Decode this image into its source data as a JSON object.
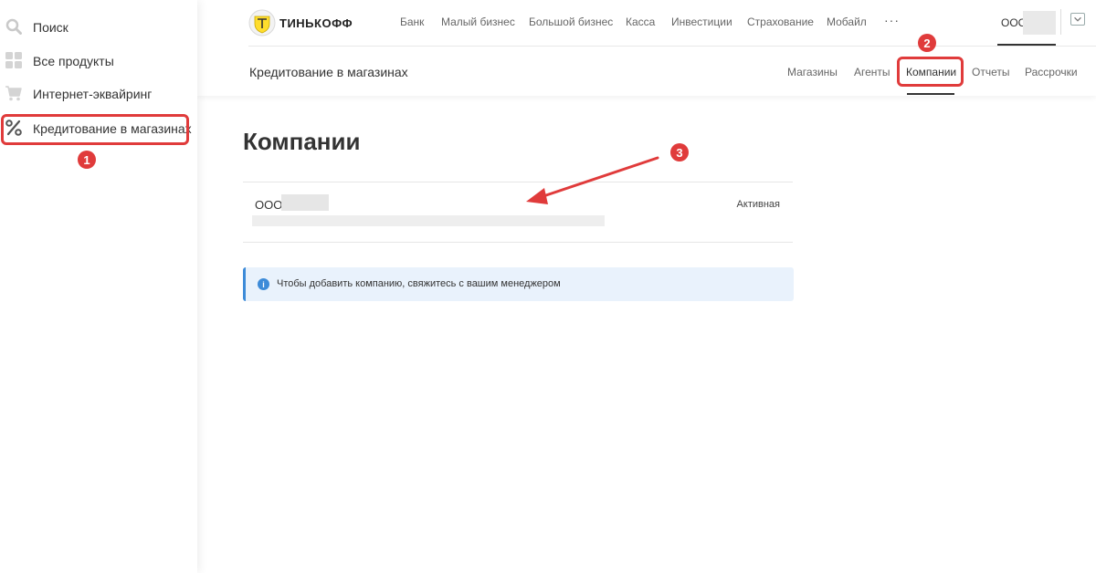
{
  "sidebar": {
    "items": [
      {
        "label": "Поиск",
        "icon": "search-icon"
      },
      {
        "label": "Все продукты",
        "icon": "grid-icon"
      },
      {
        "label": "Интернет-эквайринг",
        "icon": "cart-icon"
      },
      {
        "label": "Кредитование в магазинах",
        "icon": "percent-icon",
        "active": true
      }
    ]
  },
  "header": {
    "logo_text": "ТИНЬКОФФ",
    "nav": [
      "Банк",
      "Малый бизнес",
      "Большой бизнес",
      "Касса",
      "Инвестиции",
      "Страхование",
      "Мобайл"
    ],
    "more": "···",
    "account_name": "ООО"
  },
  "subheader": {
    "title": "Кредитование в магазинах",
    "tabs": [
      {
        "label": "Магазины"
      },
      {
        "label": "Агенты"
      },
      {
        "label": "Компании",
        "active": true
      },
      {
        "label": "Отчеты"
      },
      {
        "label": "Рассрочки"
      }
    ]
  },
  "main": {
    "title": "Компании",
    "company": {
      "name": "ООО",
      "status": "Активная"
    },
    "info": "Чтобы добавить компанию, свяжитесь с вашим менеджером"
  },
  "annotations": {
    "markers": [
      "1",
      "2",
      "3"
    ],
    "color": "#e03b3b"
  },
  "colors": {
    "info_accent": "#3d8bd8",
    "info_bg": "#e9f2fc",
    "logo_yellow": "#ffdd2d"
  }
}
